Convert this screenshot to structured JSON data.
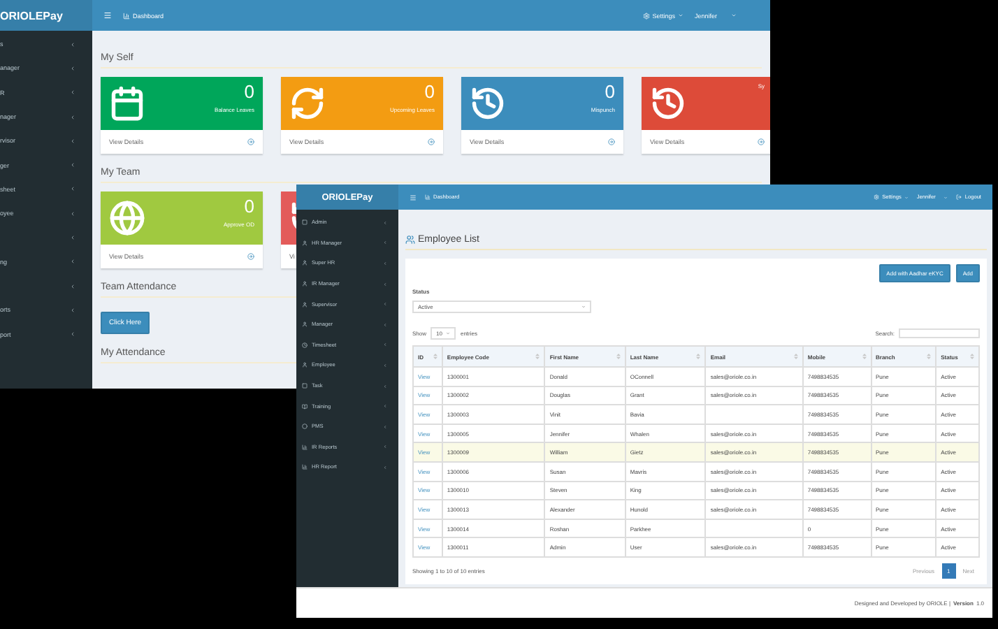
{
  "back_window": {
    "logo": "ORIOLEPay",
    "header": {
      "breadcrumb": "Dashboard",
      "settings": "Settings",
      "user": "Jennifer"
    },
    "sidebar": {
      "items": [
        {
          "label": "s",
          "has_submenu": true
        },
        {
          "label": "anager",
          "has_submenu": true
        },
        {
          "label": "R",
          "has_submenu": true
        },
        {
          "label": "nager",
          "has_submenu": true
        },
        {
          "label": "rvisor",
          "has_submenu": true
        },
        {
          "label": "ger",
          "has_submenu": true
        },
        {
          "label": "sheet",
          "has_submenu": true
        },
        {
          "label": "oyee",
          "has_submenu": true
        },
        {
          "has_submenu": true
        },
        {
          "label": "ng",
          "has_submenu": true
        },
        {
          "has_submenu": true
        },
        {
          "label": "orts",
          "has_submenu": true
        },
        {
          "label": "port",
          "has_submenu": true
        }
      ]
    },
    "sections": [
      {
        "title": "My Self",
        "cards": [
          {
            "kind": "calendar",
            "color": "#00a65a",
            "value": "0",
            "label": "Balance Leaves",
            "link": "View Details"
          },
          {
            "kind": "refresh",
            "color": "#f39c12",
            "value": "0",
            "label": "Upcoming Leaves",
            "link": "View Details"
          },
          {
            "kind": "history",
            "color": "#3c8dbc",
            "value": "0",
            "label": "Mispunch",
            "link": "View Details"
          },
          {
            "kind": "history",
            "color": "#dd4b39",
            "label": "Sy",
            "link": "View Details"
          }
        ]
      },
      {
        "title": "My Team",
        "cards": [
          {
            "kind": "globe",
            "color": "#a0c940",
            "value": "0",
            "label": "Approve OD",
            "link": "View Details"
          },
          {
            "kind": "history",
            "color": "#e35b5a",
            "link": "Vi"
          }
        ]
      },
      {
        "title": "Team Attendance",
        "button": "Click Here"
      },
      {
        "title": "My Attendance"
      }
    ]
  },
  "front_window": {
    "logo": "ORIOLEPay",
    "header": {
      "breadcrumb": "Dashboard",
      "settings": "Settings",
      "user": "Jennifer",
      "logout": "Logout"
    },
    "sidebar": {
      "items": [
        "Admin",
        "HR Manager",
        "Super HR",
        "IR Manager",
        "Supervisor",
        "Manager",
        "Timesheet",
        "Employee",
        "Task",
        "Training",
        "PMS",
        "IR Reports",
        "HR Report"
      ]
    },
    "title": "Employee List",
    "buttons": [
      "Add with Aadhar eKYC",
      "Add"
    ],
    "status_filter": {
      "label": "Status",
      "value": "Active"
    },
    "length": {
      "before": "Show",
      "value": "10",
      "after": "entries"
    },
    "search": {
      "label": "Search:"
    },
    "table": {
      "columns": [
        "ID",
        "Employee Code",
        "First Name",
        "Last Name",
        "Email",
        "Mobile",
        "Branch",
        "Status"
      ],
      "rows": [
        {
          "selected": false,
          "cells": [
            "View",
            "1300001",
            "Donald",
            "OConnell",
            "sales@oriole.co.in",
            "7498834535",
            "Pune",
            "Active"
          ]
        },
        {
          "selected": false,
          "cells": [
            "View",
            "1300002",
            "Douglas",
            "Grant",
            "sales@oriole.co.in",
            "7498834535",
            "Pune",
            "Active"
          ]
        },
        {
          "selected": false,
          "cells": [
            "View",
            "1300003",
            "Vinit",
            "Bavia",
            "",
            "7498834535",
            "Pune",
            "Active"
          ]
        },
        {
          "selected": false,
          "cells": [
            "View",
            "1300005",
            "Jennifer",
            "Whalen",
            "sales@oriole.co.in",
            "7498834535",
            "Pune",
            "Active"
          ]
        },
        {
          "selected": true,
          "cells": [
            "View",
            "1300009",
            "William",
            "Gietz",
            "sales@oriole.co.in",
            "7498834535",
            "Pune",
            "Active"
          ]
        },
        {
          "selected": false,
          "cells": [
            "View",
            "1300006",
            "Susan",
            "Mavris",
            "sales@oriole.co.in",
            "7498834535",
            "Pune",
            "Active"
          ]
        },
        {
          "selected": false,
          "cells": [
            "View",
            "1300010",
            "Steven",
            "King",
            "sales@oriole.co.in",
            "7498834535",
            "Pune",
            "Active"
          ]
        },
        {
          "selected": false,
          "cells": [
            "View",
            "1300013",
            "Alexander",
            "Hunold",
            "sales@oriole.co.in",
            "7498834535",
            "Pune",
            "Active"
          ]
        },
        {
          "selected": false,
          "cells": [
            "View",
            "1300014",
            "Roshan",
            "Parkhee",
            "",
            "0",
            "Pune",
            "Active"
          ]
        },
        {
          "selected": false,
          "cells": [
            "View",
            "1300011",
            "Admin",
            "User",
            "sales@oriole.co.in",
            "7498834535",
            "Pune",
            "Active"
          ]
        }
      ]
    },
    "info": "Showing 1 to 10 of 10 entries",
    "pagination": [
      {
        "label": "Previous",
        "selected": false
      },
      {
        "label": "1",
        "selected": true
      },
      {
        "label": "Next",
        "selected": false
      }
    ],
    "footer": {
      "text": "Designed and Developed by ORIOLE |",
      "version": "Version",
      "number": "1.0"
    }
  }
}
